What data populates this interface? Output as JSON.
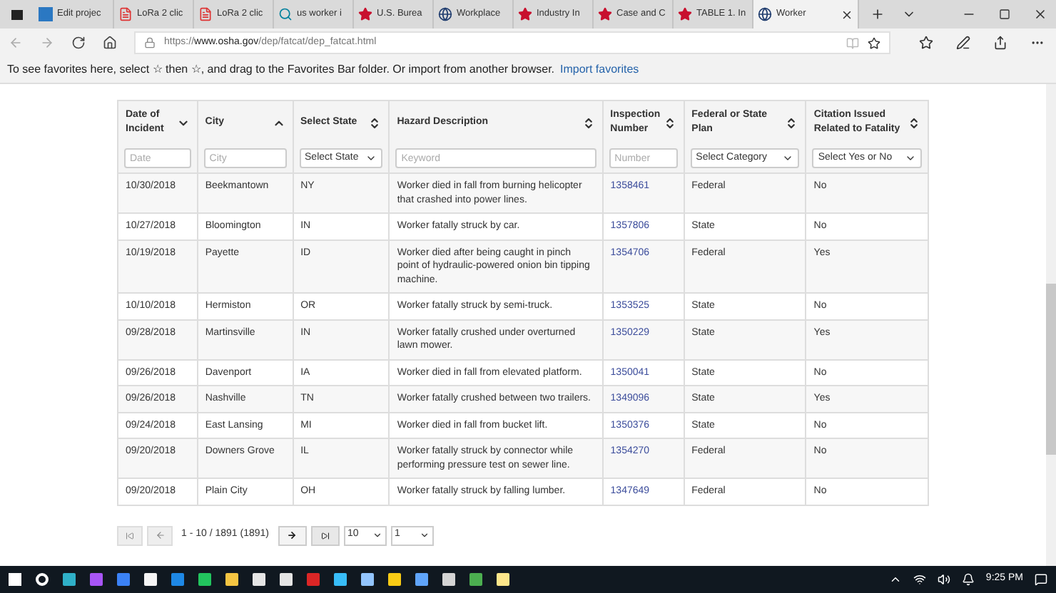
{
  "tabs": [
    {
      "label": "Edit projec",
      "kind": "doc",
      "selected": false
    },
    {
      "label": "LoRa 2 clic",
      "kind": "pdf",
      "selected": false
    },
    {
      "label": "LoRa 2 clic",
      "kind": "pdf",
      "selected": false
    },
    {
      "label": "us worker i",
      "kind": "search",
      "selected": false
    },
    {
      "label": "U.S. Burea",
      "kind": "star",
      "selected": false
    },
    {
      "label": "Workplace",
      "kind": "globe",
      "selected": false
    },
    {
      "label": "Industry In",
      "kind": "star",
      "selected": false
    },
    {
      "label": "Case and C",
      "kind": "star",
      "selected": false
    },
    {
      "label": "TABLE 1. In",
      "kind": "star",
      "selected": false
    },
    {
      "label": "Worker",
      "kind": "globe",
      "selected": true
    }
  ],
  "address": {
    "prefix": "https://",
    "domain": "www.osha.gov",
    "path": "/dep/fatcat/dep_fatcat.html"
  },
  "favorites_bar": {
    "message": "To see favorites here, select ☆ then ☆, and drag to the Favorites Bar folder. Or import from another browser.",
    "link": "Import favorites"
  },
  "table": {
    "columns": [
      {
        "label": "Date of Incident",
        "kind": "desc",
        "filter": {
          "kind": "text",
          "placeholder": "Date"
        }
      },
      {
        "label": "City",
        "kind": "asc",
        "filter": {
          "kind": "text",
          "placeholder": "City"
        }
      },
      {
        "label": "Select State",
        "kind": "sortable",
        "filter": {
          "kind": "select",
          "value": "Select State"
        }
      },
      {
        "label": "Hazard Description",
        "kind": "sortable",
        "filter": {
          "kind": "text",
          "placeholder": "Keyword"
        }
      },
      {
        "label": "Inspection Number",
        "kind": "sortable",
        "filter": {
          "kind": "text",
          "placeholder": "Number"
        }
      },
      {
        "label": "Federal or State Plan",
        "kind": "sortable",
        "filter": {
          "kind": "select",
          "value": "Select Category"
        }
      },
      {
        "label": "Citation Issued Related to Fatality",
        "kind": "sortable",
        "filter": {
          "kind": "select",
          "value": "Select Yes or No"
        }
      }
    ],
    "rows": [
      [
        "10/30/2018",
        "Beekmantown",
        "NY",
        "Worker died in fall from burning helicopter that crashed into power lines.",
        "1358461",
        "Federal",
        "No"
      ],
      [
        "10/27/2018",
        "Bloomington",
        "IN",
        "Worker fatally struck by car.",
        "1357806",
        "State",
        "No"
      ],
      [
        "10/19/2018",
        "Payette",
        "ID",
        "Worker died after being caught in pinch point of hydraulic-powered onion bin tipping machine.",
        "1354706",
        "Federal",
        "Yes"
      ],
      [
        "10/10/2018",
        "Hermiston",
        "OR",
        "Worker fatally struck by semi-truck.",
        "1353525",
        "State",
        "No"
      ],
      [
        "09/28/2018",
        "Martinsville",
        "IN",
        "Worker fatally crushed under overturned lawn mower.",
        "1350229",
        "State",
        "Yes"
      ],
      [
        "09/26/2018",
        "Davenport",
        "IA",
        "Worker died in fall from elevated platform.",
        "1350041",
        "State",
        "No"
      ],
      [
        "09/26/2018",
        "Nashville",
        "TN",
        "Worker fatally crushed between two trailers.",
        "1349096",
        "State",
        "Yes"
      ],
      [
        "09/24/2018",
        "East Lansing",
        "MI",
        "Worker died in fall from bucket lift.",
        "1350376",
        "State",
        "No"
      ],
      [
        "09/20/2018",
        "Downers Grove",
        "IL",
        "Worker fatally struck by connector while performing pressure test on sewer line.",
        "1354270",
        "Federal",
        "No"
      ],
      [
        "09/20/2018",
        "Plain City",
        "OH",
        "Worker fatally struck by falling lumber.",
        "1347649",
        "Federal",
        "No"
      ]
    ]
  },
  "pagination": {
    "summary": "1 - 10 / 1891 (1891)",
    "page_size": "10",
    "page": "1"
  },
  "taskbar": {
    "time": "9:25 PM"
  }
}
